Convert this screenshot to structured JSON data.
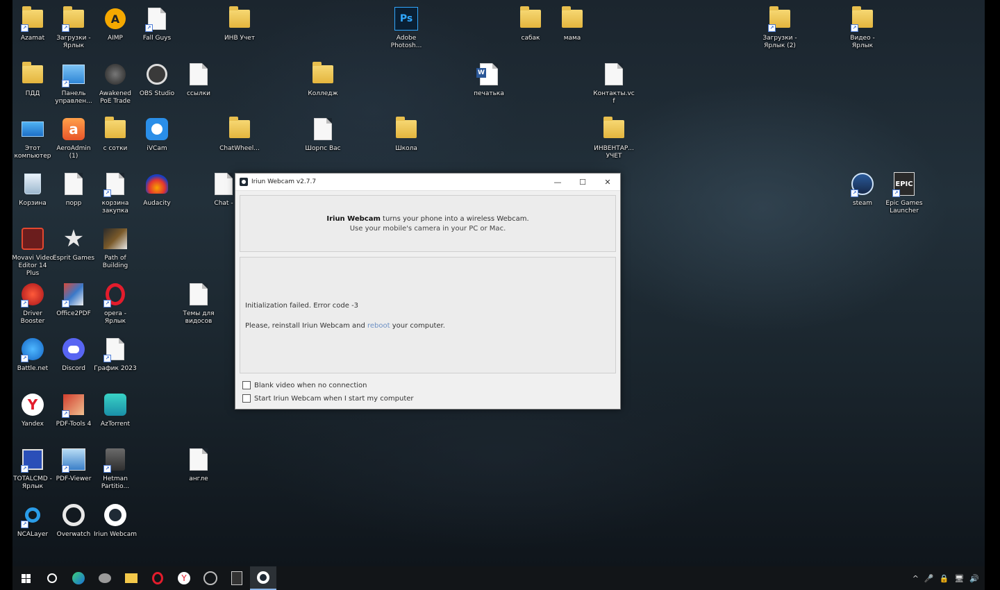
{
  "desktop_icons": [
    {
      "label": "Azamat",
      "type": "folder"
    },
    {
      "label": "Загрузки - Ярлык",
      "type": "folder"
    },
    {
      "label": "AIMP",
      "type": "app"
    },
    {
      "label": "Fall Guys",
      "type": "file"
    },
    {
      "label": "ИНВ Учет",
      "type": "folder"
    },
    {
      "label": "Adobe Photosh...",
      "type": "app"
    },
    {
      "label": "сабак",
      "type": "folder"
    },
    {
      "label": "мама",
      "type": "folder"
    },
    {
      "label": "Загрузки - Ярлык (2)",
      "type": "folder"
    },
    {
      "label": "Видео - Ярлык",
      "type": "folder"
    },
    {
      "label": "ПДД",
      "type": "folder"
    },
    {
      "label": "Панель управлен...",
      "type": "app"
    },
    {
      "label": "Awakened PoE Trade",
      "type": "app"
    },
    {
      "label": "OBS Studio",
      "type": "app"
    },
    {
      "label": "ссылки",
      "type": "file"
    },
    {
      "label": "Колледж",
      "type": "folder"
    },
    {
      "label": "печатька",
      "type": "file"
    },
    {
      "label": "Контакты.vcf",
      "type": "file"
    },
    {
      "label": "Этот компьютер",
      "type": "app"
    },
    {
      "label": "AeroAdmin (1)",
      "type": "app"
    },
    {
      "label": "с сотки",
      "type": "folder"
    },
    {
      "label": "iVCam",
      "type": "app"
    },
    {
      "label": "ChatWheel...",
      "type": "folder"
    },
    {
      "label": "Шорпс Вас",
      "type": "file"
    },
    {
      "label": "Школа",
      "type": "folder"
    },
    {
      "label": "ИНВЕНТАР... УЧЕТ",
      "type": "folder"
    },
    {
      "label": "Корзина",
      "type": "app"
    },
    {
      "label": "порр",
      "type": "file"
    },
    {
      "label": "корзина закупка",
      "type": "file"
    },
    {
      "label": "Audacity",
      "type": "app"
    },
    {
      "label": "Chat -",
      "type": "file"
    },
    {
      "label": "steam",
      "type": "app"
    },
    {
      "label": "Epic Games Launcher",
      "type": "app"
    },
    {
      "label": "Movavi Video Editor 14 Plus",
      "type": "app"
    },
    {
      "label": "Esprit Games",
      "type": "app"
    },
    {
      "label": "Path of Building",
      "type": "app"
    },
    {
      "label": "Driver Booster",
      "type": "app"
    },
    {
      "label": "Office2PDF",
      "type": "app"
    },
    {
      "label": "opera - Ярлык",
      "type": "app"
    },
    {
      "label": "Темы для видосов",
      "type": "file"
    },
    {
      "label": "Battle.net",
      "type": "app"
    },
    {
      "label": "Discord",
      "type": "app"
    },
    {
      "label": "График 2023",
      "type": "file"
    },
    {
      "label": "Yandex",
      "type": "app"
    },
    {
      "label": "PDF-Tools 4",
      "type": "app"
    },
    {
      "label": "AzTorrent",
      "type": "app"
    },
    {
      "label": "TOTALCMD - Ярлык",
      "type": "app"
    },
    {
      "label": "PDF-Viewer",
      "type": "app"
    },
    {
      "label": "Hetman Partitio...",
      "type": "app"
    },
    {
      "label": "англе",
      "type": "file"
    },
    {
      "label": "NCALayer",
      "type": "app"
    },
    {
      "label": "Overwatch",
      "type": "app"
    },
    {
      "label": "Iriun Webcam",
      "type": "app"
    }
  ],
  "dialog": {
    "title": "Iriun Webcam v2.7.7",
    "info_brand": "Iriun Webcam",
    "info_line1_rest": " turns your phone into a wireless Webcam.",
    "info_line2": "Use your mobile's camera in your PC or Mac.",
    "error_text": "Initialization failed. Error code -3",
    "hint_prefix": "Please, reinstall Iriun Webcam and ",
    "hint_highlight": "reboot",
    "hint_suffix": " your computer.",
    "checkbox_blank_video": "Blank video when no connection",
    "checkbox_autostart": "Start Iriun Webcam when I start my computer",
    "minimize_symbol": "—",
    "maximize_symbol": "☐",
    "close_symbol": "✕"
  },
  "taskbar": {
    "items": [
      "start-icon",
      "search-icon",
      "edge-icon",
      "app-icon",
      "file-explorer-icon",
      "opera-icon",
      "yandex-icon",
      "steam-icon",
      "epic-games-icon",
      "iriun-webcam-icon"
    ],
    "tray_symbols": [
      "^",
      "🎤",
      "🔒",
      "🖥",
      "🔊"
    ]
  }
}
